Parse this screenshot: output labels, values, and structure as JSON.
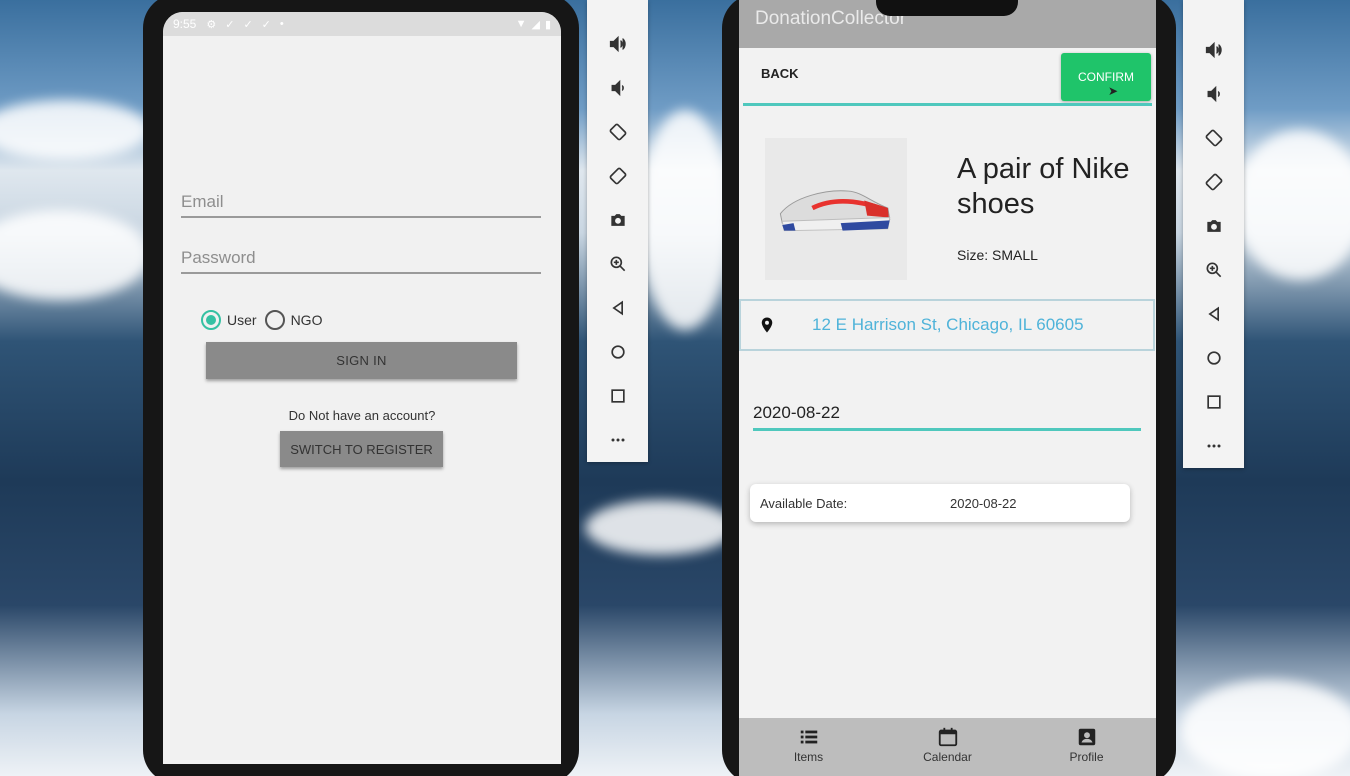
{
  "login": {
    "status_time": "9:55",
    "email_placeholder": "Email",
    "password_placeholder": "Password",
    "role_user": "User",
    "role_ngo": "NGO",
    "selected_role": "User",
    "signin_label": "SIGN IN",
    "account_prompt": "Do Not have an account?",
    "register_label": "SWITCH TO REGISTER"
  },
  "emulator_toolbar": {
    "buttons": [
      "volume-up-icon",
      "volume-down-icon",
      "rotate-left-icon",
      "rotate-right-icon",
      "camera-icon",
      "zoom-icon",
      "back-icon",
      "home-icon",
      "overview-icon",
      "more-icon"
    ]
  },
  "donation": {
    "app_title": "DonationCollector",
    "back_label": "BACK",
    "confirm_label": "CONFIRM",
    "product_title": "A pair of Nike shoes",
    "product_size": "Size: SMALL",
    "address": "12 E Harrison St, Chicago, IL 60605",
    "date_value": "2020-08-22",
    "available_label": "Available Date:",
    "available_value": "2020-08-22",
    "nav": [
      {
        "label": "Items",
        "icon": "list-icon"
      },
      {
        "label": "Calendar",
        "icon": "calendar-icon"
      },
      {
        "label": "Profile",
        "icon": "profile-icon"
      }
    ]
  },
  "colors": {
    "accent_teal": "#4fc8bd",
    "confirm_green": "#1fc46a",
    "address_blue": "#4fb3d9",
    "radio_teal": "#35c1a3"
  }
}
